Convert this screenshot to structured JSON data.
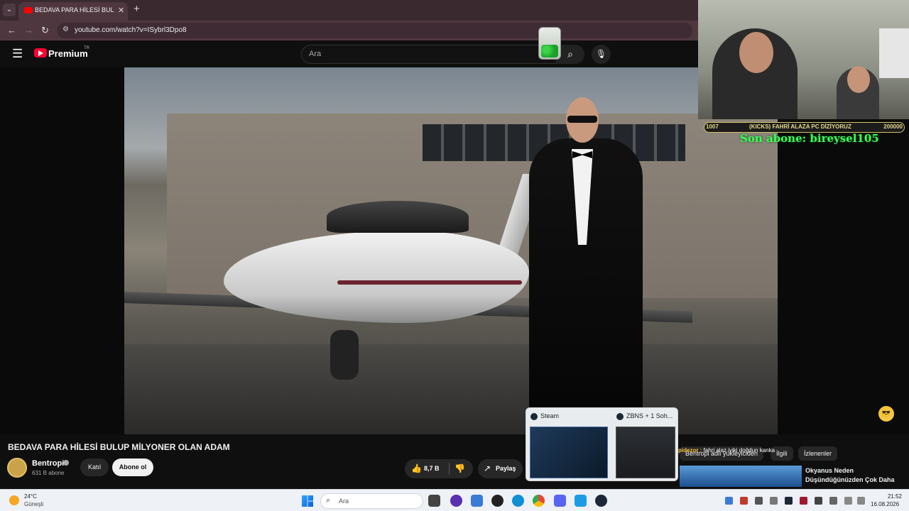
{
  "browser": {
    "tab_title": "BEDAVA PARA HİLESİ BULUP Mİ",
    "tab_close": "✕",
    "new_tab": "+",
    "url": "youtube.com/watch?v=ISybrl3Dpo8"
  },
  "youtube": {
    "brand": "Premium",
    "brand_region": "TR",
    "search_placeholder": "Ara"
  },
  "video": {
    "title": "BEDAVA PARA HİLESİ BULUP MİLYONER OLAN ADAM",
    "channel": "Bentropi",
    "subscribers": "631 B abone",
    "join_label": "Katıl",
    "subscribe_label": "Abone ol",
    "likes": "8,7 B",
    "share_label": "Paylaş"
  },
  "chat": {
    "user": "pidezor :",
    "message": " fahri alaz iyiki doğdun kanka"
  },
  "recommendations": {
    "tabs": [
      "Bentropi adlı yükleyiciden",
      "İlgili",
      "İzlenenler"
    ],
    "first_title": "Okyanus Neden Düşündüğünüzden Çok Daha"
  },
  "stream_overlay": {
    "goal_current": "1007",
    "goal_label": "(KICKS) FAHRİ ALAZA PC DİZİYORUZ",
    "goal_target": "200000",
    "last_subscriber": "Son abone: bireysel105"
  },
  "taskbar_preview": {
    "items": [
      "Steam",
      "ZBNS + 1 Soh..."
    ]
  },
  "taskbar": {
    "weather_temp": "24°C",
    "weather_text": "Güneşli",
    "search_text": "Ara",
    "time": "21:52",
    "date": "16.08.2026"
  },
  "colors": {
    "accent_red": "#ff0033",
    "browser_frame": "#3a2a30",
    "overlay_green": "#3dfc5a",
    "goal_gold": "#e5d98a"
  }
}
